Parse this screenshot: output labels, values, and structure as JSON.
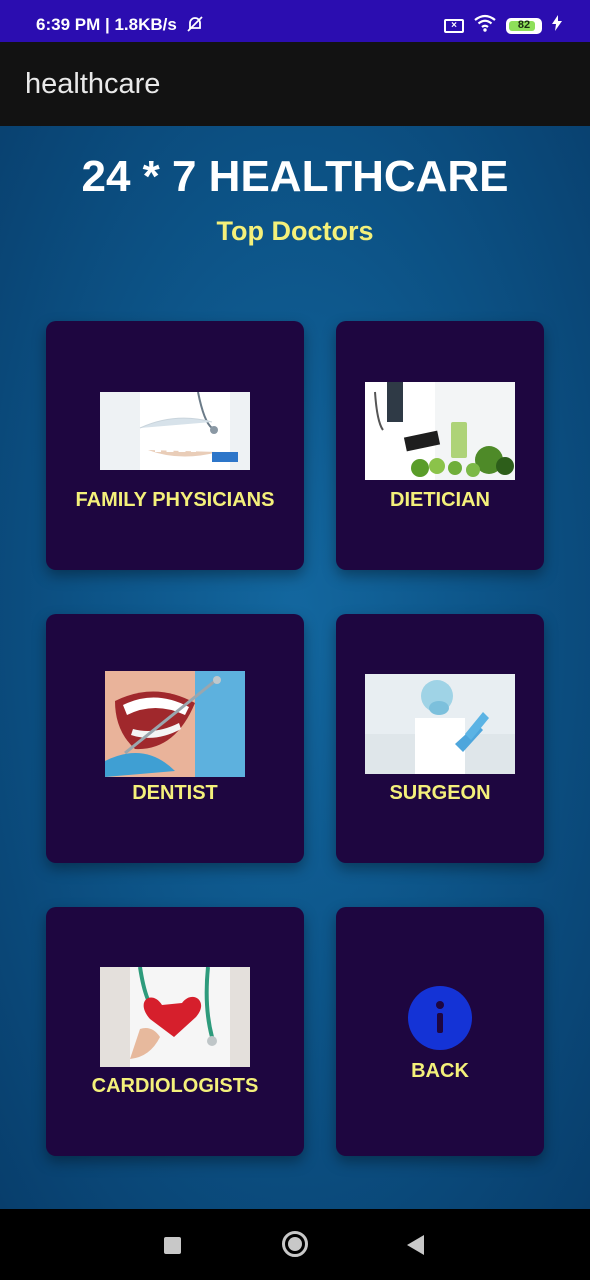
{
  "status_bar": {
    "time_speed": "6:39 PM | 1.8KB/s",
    "battery": "82"
  },
  "app_bar": {
    "title": "healthcare"
  },
  "header": {
    "title": "24 * 7 HEALTHCARE",
    "subtitle": "Top Doctors"
  },
  "cards": [
    {
      "label": "FAMILY PHYSICIANS"
    },
    {
      "label": "DIETICIAN"
    },
    {
      "label": "DENTIST"
    },
    {
      "label": "SURGEON"
    },
    {
      "label": "CARDIOLOGISTS"
    },
    {
      "label": "BACK"
    }
  ],
  "colors": {
    "status_bar": "#2b0db0",
    "app_bar": "#121212",
    "background": "#0d5589",
    "card": "#1e0640",
    "accent_text": "#f4f07a",
    "info_icon": "#1433d6"
  }
}
